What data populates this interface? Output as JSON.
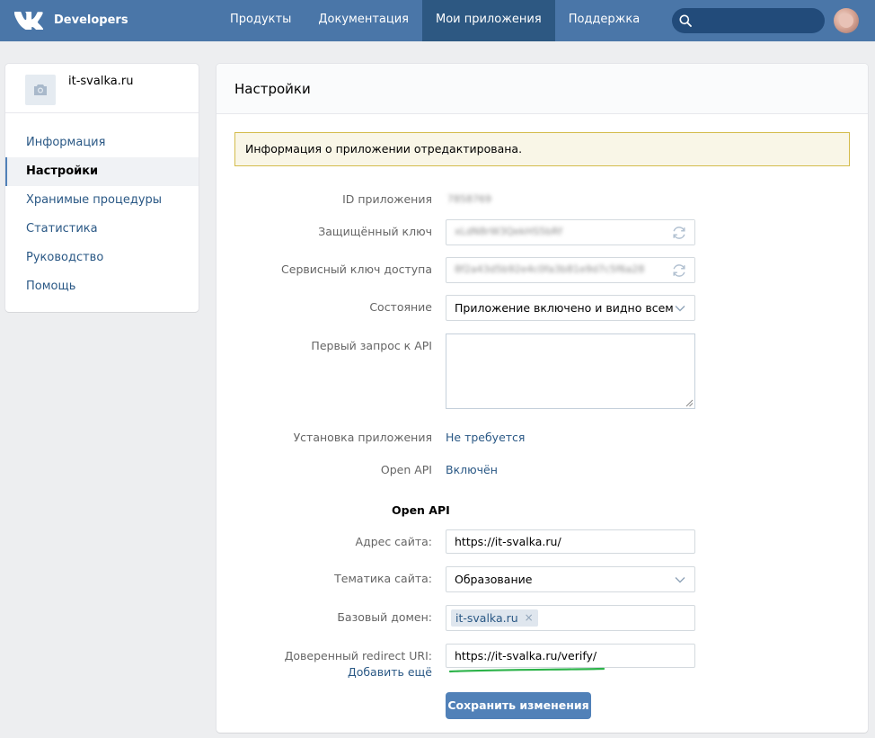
{
  "brand": {
    "name": "Developers"
  },
  "nav": [
    {
      "label": "Продукты",
      "active": false
    },
    {
      "label": "Документация",
      "active": false
    },
    {
      "label": "Мои приложения",
      "active": true
    },
    {
      "label": "Поддержка",
      "active": false
    }
  ],
  "search": {
    "placeholder": "",
    "value": ""
  },
  "sidebar": {
    "app_name": "it-svalka.ru",
    "items": [
      {
        "label": "Информация",
        "active": false
      },
      {
        "label": "Настройки",
        "active": true
      },
      {
        "label": "Хранимые процедуры",
        "active": false
      },
      {
        "label": "Статистика",
        "active": false
      },
      {
        "label": "Руководство",
        "active": false
      },
      {
        "label": "Помощь",
        "active": false
      }
    ]
  },
  "main": {
    "title": "Настройки",
    "notice": "Информация о приложении отредактирована.",
    "fields": {
      "app_id": {
        "label": "ID приложения",
        "value": "7858769"
      },
      "secret_key": {
        "label": "Защищённый ключ",
        "value": "xLdN8rW3QekHS5bRf"
      },
      "service_key": {
        "label": "Сервисный ключ доступа",
        "value": "8f2a43d5b92e4c0fa3b81e9d7c5f6a28"
      },
      "state": {
        "label": "Состояние",
        "value": "Приложение включено и видно всем"
      },
      "first_request": {
        "label": "Первый запрос к API",
        "value": ""
      },
      "install": {
        "label": "Установка приложения",
        "value": "Не требуется"
      },
      "open_api": {
        "label": "Open API",
        "value": "Включён"
      }
    },
    "open_api_section": {
      "title": "Open API",
      "site_address": {
        "label": "Адрес сайта:",
        "value": "https://it-svalka.ru/"
      },
      "site_topic": {
        "label": "Тематика сайта:",
        "value": "Образование"
      },
      "base_domain": {
        "label": "Базовый домен:",
        "tag": "it-svalka.ru",
        "remove_glyph": "×"
      },
      "redirect_uri": {
        "label": "Доверенный redirect URI:",
        "value": "https://it-svalka.ru/verify/"
      },
      "add_more": "Добавить ещё"
    },
    "save_button": "Сохранить изменения"
  },
  "colors": {
    "topbar": "#4a76a8",
    "nav_active": "#2d5882",
    "link": "#2a5885",
    "button": "#5181b8",
    "notice_bg": "#f9f6e7",
    "notice_border": "#d4bc4c",
    "annotation_underline": "#2db34a"
  },
  "icons": {
    "logo": "vk-logo-icon",
    "search": "search-icon",
    "camera": "camera-icon",
    "refresh": "refresh-icon",
    "chevron": "chevron-down-icon"
  }
}
